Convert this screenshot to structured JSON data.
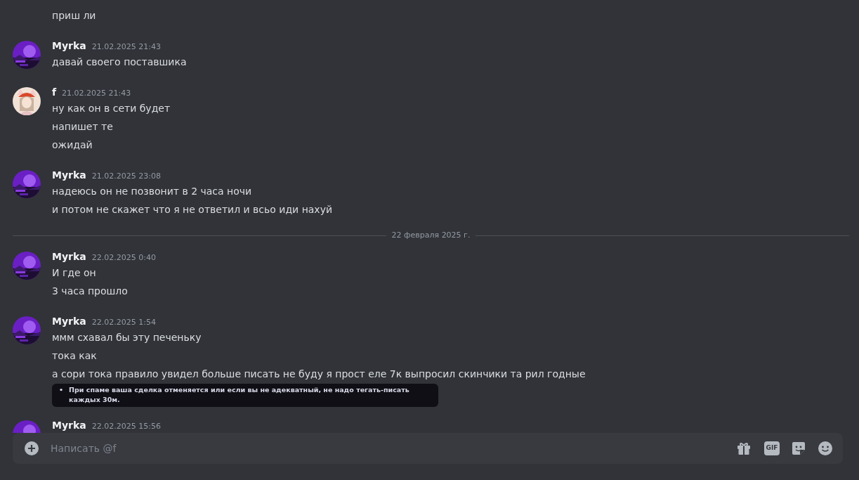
{
  "messages": [
    {
      "lines": [
        "приш ли"
      ]
    },
    {
      "author": "Myrka",
      "time": "21.02.2025 21:43",
      "lines": [
        "давай своего поставшика"
      ]
    },
    {
      "author": "f",
      "time": "21.02.2025 21:43",
      "lines": [
        "ну как он в сети будет",
        "напишет те",
        "ожидай"
      ]
    },
    {
      "author": "Myrka",
      "time": "21.02.2025 23:08",
      "lines": [
        "надеюсь он не позвонит в 2 часа ночи",
        "и потом не скажет что я не ответил и всьо иди нахуй"
      ]
    },
    {
      "divider": "22 февраля 2025 г."
    },
    {
      "author": "Myrka",
      "time": "22.02.2025 0:40",
      "lines": [
        "И где он",
        "3 часа прошло"
      ]
    },
    {
      "author": "Myrka",
      "time": "22.02.2025 1:54",
      "lines": [
        "ммм схавал бы эту печеньку",
        "тока как",
        "а сори тока правило увидел больше писать не буду я прост еле 7к выпросил скинчики та рил годные"
      ],
      "attachment": {
        "bullet": "•",
        "text": "При спаме ваша сделка отменяется или если вы не адекватный, не надо тегать-писать каждых 30м."
      }
    },
    {
      "author": "Myrka",
      "time": "22.02.2025 15:56"
    }
  ],
  "composer": {
    "placeholder": "Написать @f",
    "gif_label": "GIF"
  }
}
